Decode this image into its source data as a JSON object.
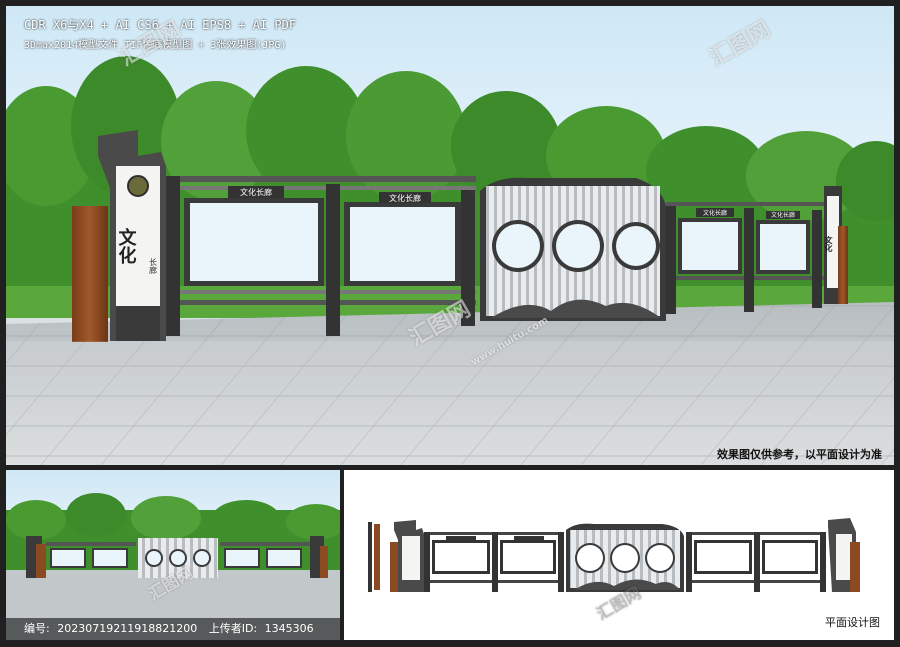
{
  "header": {
    "formats": "CDR X6与X4 + AI CS6 + AI EPS8 + AI PDF",
    "extras": "3Dmax2014模型文件 TIF稀底模型图 + 3张效果图(JPG)"
  },
  "sign": {
    "board_tag_1": "文化长廊",
    "board_tag_2": "文化长廊",
    "board_tag_3": "文化长廊",
    "board_tag_4": "文化长廊",
    "pillar_title": "文化",
    "pillar_sub": "长廊",
    "right_pillar_title": "文化"
  },
  "disclaimer": "效果图仅供参考，以平面设计为准",
  "plan_label": "平面设计图",
  "meta": {
    "id_label": "编号:",
    "id_value": "20230719211918821200",
    "uploader_label": "上传者ID:",
    "uploader_value": "1345306"
  },
  "watermark": {
    "text": "汇图网",
    "url": "www.huitu.com"
  },
  "colors": {
    "frame": "#2b2b2b",
    "sky": "#cfe8f6",
    "tree": "#3f8f2c",
    "floor": "#c9cfd2",
    "wood": "#8a4a22",
    "board": "#eef6fa",
    "accent_dark": "#3a3a3a"
  }
}
